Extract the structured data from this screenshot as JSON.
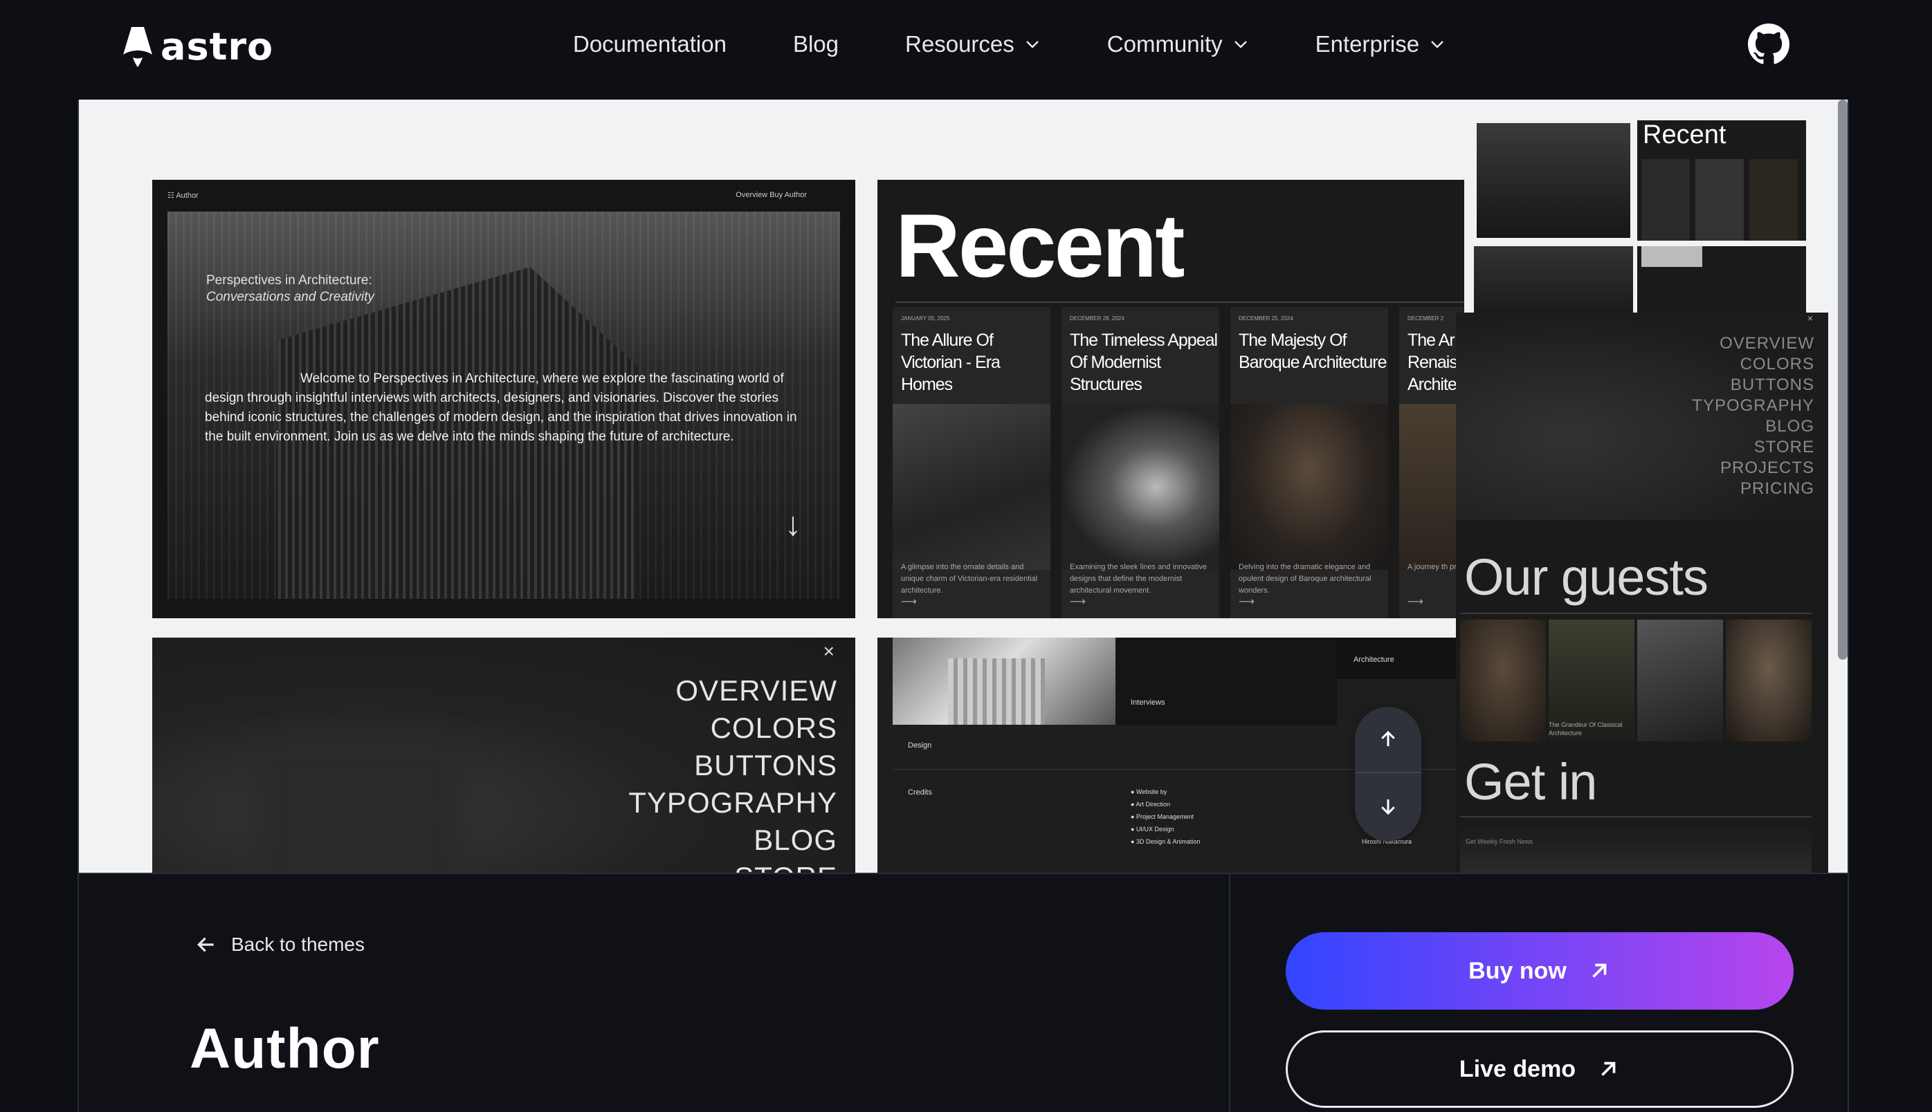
{
  "header": {
    "logo_text": "astro",
    "nav": [
      {
        "label": "Documentation",
        "dropdown": false
      },
      {
        "label": "Blog",
        "dropdown": false
      },
      {
        "label": "Resources",
        "dropdown": true
      },
      {
        "label": "Community",
        "dropdown": true
      },
      {
        "label": "Enterprise",
        "dropdown": true
      }
    ],
    "github_icon": "github-icon"
  },
  "preview": {
    "card1": {
      "brand": "Author",
      "nav": "Overview    Buy Author",
      "kicker": "Perspectives in Architecture:",
      "kicker_italic": "Conversations and Creativity",
      "body": "Welcome to Perspectives in Architecture, where we explore the fascinating world of design through insightful interviews with architects, designers, and visionaries. Discover the stories behind iconic structures, the challenges of modern design, and the inspiration that drives innovation in the built environment. Join us as we delve into the minds shaping the future of architecture."
    },
    "card2": {
      "title": "Recent",
      "posts": [
        {
          "date": "JANUARY 05, 2025",
          "title": "The Allure Of Victorian - Era Homes",
          "desc": "A glimpse into the ornate details and unique charm of Victorian-era residential architecture."
        },
        {
          "date": "DECEMBER 28, 2024",
          "title": "The Timeless Appeal Of Modernist Structures",
          "desc": "Examining the sleek lines and innovative designs that define the modernist architectural movement."
        },
        {
          "date": "DECEMBER 25, 2024",
          "title": "The Majesty Of Baroque Architecture",
          "desc": "Delving into the dramatic elegance and opulent design of Baroque architectural wonders."
        },
        {
          "date": "DECEMBER 2",
          "title": "The Ar Renais Archite",
          "desc": "A journey th proportions a Renaissance"
        }
      ]
    },
    "card3": {
      "menu": [
        "OVERVIEW",
        "COLORS",
        "BUTTONS",
        "TYPOGRAPHY",
        "BLOG",
        "STORE"
      ]
    },
    "card4": {
      "architecture": "Architecture",
      "interviews": "Interviews",
      "design": "Design",
      "credits": "Credits",
      "credit_items": [
        "Website by",
        "Art Direction",
        "Project Management",
        "UI/UX Design",
        "3D Design & Animation"
      ],
      "credit_name": "Hiroshi Nakamura"
    },
    "right": {
      "recent_title": "Recent",
      "menu": [
        "OVERVIEW",
        "COLORS",
        "BUTTONS",
        "TYPOGRAPHY",
        "BLOG",
        "STORE",
        "PROJECTS",
        "PRICING"
      ],
      "guests_title": "Our guests",
      "guest_caption": "The Grandeur Of Classical Architecture",
      "getin_title": "Get in",
      "footer_caption": "Get Weekly Fresh News"
    }
  },
  "bottom": {
    "back_label": "Back to themes",
    "theme_title": "Author",
    "buy_label": "Buy now",
    "live_label": "Live demo"
  },
  "colors": {
    "bg": "#0d0f14",
    "buy_gradient_start": "#3245ff",
    "buy_gradient_end": "#b845ed"
  }
}
